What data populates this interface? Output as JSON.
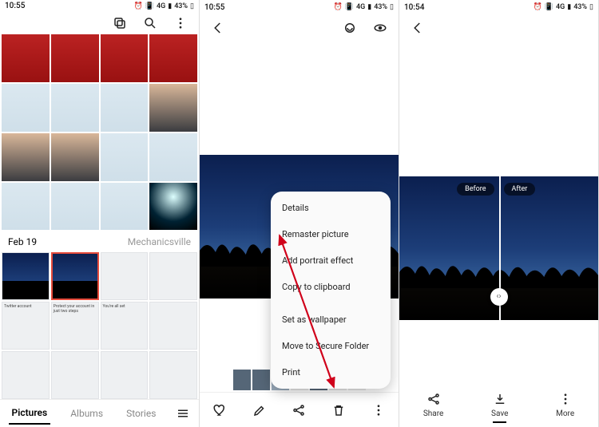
{
  "status": {
    "time1": "10:55",
    "time2": "10:55",
    "time3": "10:54",
    "net": "4G",
    "battery": "43%"
  },
  "panel1": {
    "section_date": "Feb 19",
    "section_location": "Mechanicsville",
    "tabs": {
      "pictures": "Pictures",
      "albums": "Albums",
      "stories": "Stories"
    },
    "card_texts": {
      "twitter": "Twitter account",
      "protect": "Protect your account in just two steps",
      "allset": "You're all set"
    }
  },
  "panel2": {
    "menu": {
      "details": "Details",
      "remaster": "Remaster picture",
      "portrait": "Add portrait effect",
      "copy": "Copy to clipboard",
      "wallpaper": "Set as wallpaper",
      "secure": "Move to Secure Folder",
      "print": "Print"
    }
  },
  "panel3": {
    "before": "Before",
    "after": "After",
    "actions": {
      "share": "Share",
      "save": "Save",
      "more": "More"
    }
  }
}
